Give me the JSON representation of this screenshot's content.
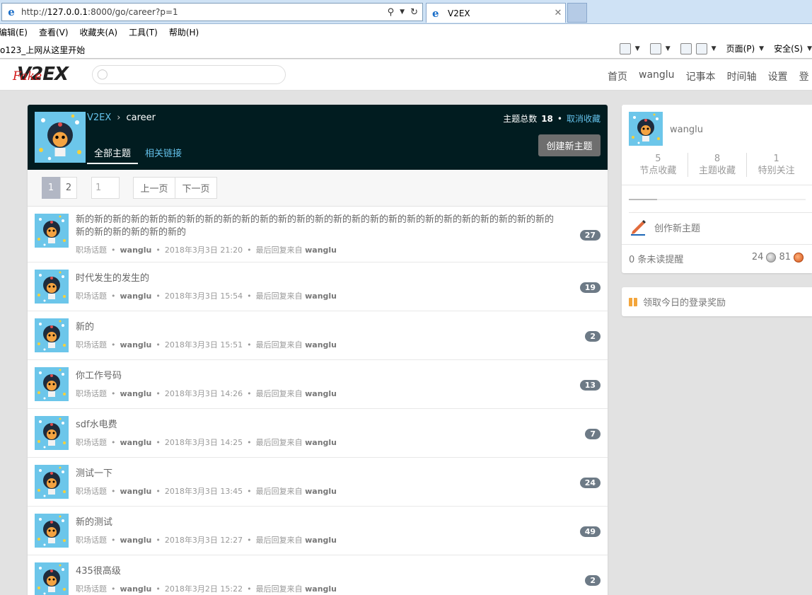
{
  "browser": {
    "address_prefix": "http://",
    "address_host": "127.0.0.1",
    "address_rest": ":8000/go/career?p=1",
    "tab_title": "V2EX",
    "tab_close": "✕",
    "menu": [
      "编辑(E)",
      "查看(V)",
      "收藏夹(A)",
      "工具(T)",
      "帮助(H)"
    ],
    "fav_link": "o123_上网从这里开始",
    "tool_page": "页面(P)",
    "tool_safety": "安全(S)"
  },
  "site": {
    "logo_main": "V2EX",
    "logo_overlay": "Fake",
    "search_placeholder": "",
    "nav": [
      "首页",
      "wanglu",
      "记事本",
      "时间轴",
      "设置",
      "登"
    ]
  },
  "node": {
    "crumb_home": "V2EX",
    "crumb_sep": "›",
    "crumb_node": "career",
    "total_label": "主题总数",
    "total_value": "18",
    "dot": "•",
    "unfav": "取消收藏",
    "tab_all": "全部主题",
    "tab_links": "相关链接",
    "create_btn": "创建新主题"
  },
  "pager": {
    "pages": [
      "1",
      "2"
    ],
    "jump_value": "1",
    "prev": "上一页",
    "next": "下一页"
  },
  "topics": [
    {
      "title": "新的新的新的新的新的新的新的新的新的新的新的新的新的新的新的新的新的新的新的新的新的新的新的新的新的新的新的新的新的新的新的新的",
      "node": "职场话题",
      "author": "wanglu",
      "time": "2018年3月3日 21:20",
      "last_prefix": "最后回复来自",
      "last_user": "wanglu",
      "replies": "27"
    },
    {
      "title": "时代发生的发生的",
      "node": "职场话题",
      "author": "wanglu",
      "time": "2018年3月3日 15:54",
      "last_prefix": "最后回复来自",
      "last_user": "wanglu",
      "replies": "19"
    },
    {
      "title": "新的",
      "node": "职场话题",
      "author": "wanglu",
      "time": "2018年3月3日 15:51",
      "last_prefix": "最后回复来自",
      "last_user": "wanglu",
      "replies": "2"
    },
    {
      "title": "你工作号码",
      "node": "职场话题",
      "author": "wanglu",
      "time": "2018年3月3日 14:26",
      "last_prefix": "最后回复来自",
      "last_user": "wanglu",
      "replies": "13"
    },
    {
      "title": "sdf水电费",
      "node": "职场话题",
      "author": "wanglu",
      "time": "2018年3月3日 14:25",
      "last_prefix": "最后回复来自",
      "last_user": "wanglu",
      "replies": "7"
    },
    {
      "title": "测试一下",
      "node": "职场话题",
      "author": "wanglu",
      "time": "2018年3月3日 13:45",
      "last_prefix": "最后回复来自",
      "last_user": "wanglu",
      "replies": "24"
    },
    {
      "title": "新的测试",
      "node": "职场话题",
      "author": "wanglu",
      "time": "2018年3月3日 12:27",
      "last_prefix": "最后回复来自",
      "last_user": "wanglu",
      "replies": "49"
    },
    {
      "title": "435很高级",
      "node": "职场话题",
      "author": "wanglu",
      "time": "2018年3月2日 15:22",
      "last_prefix": "最后回复来自",
      "last_user": "wanglu",
      "replies": "2"
    }
  ],
  "sidebar": {
    "username": "wanglu",
    "counts": [
      {
        "num": "5",
        "label": "节点收藏"
      },
      {
        "num": "8",
        "label": "主题收藏"
      },
      {
        "num": "1",
        "label": "特别关注"
      }
    ],
    "progress_fraction": 0.16,
    "create": "创作新主题",
    "unread": "0 条未读提醒",
    "silver": "24",
    "bronze": "81",
    "daily": "领取今日的登录奖励"
  },
  "colors": {
    "header_bg": "#011c20",
    "link": "#64c1ea",
    "logo_red": "#d31919"
  }
}
